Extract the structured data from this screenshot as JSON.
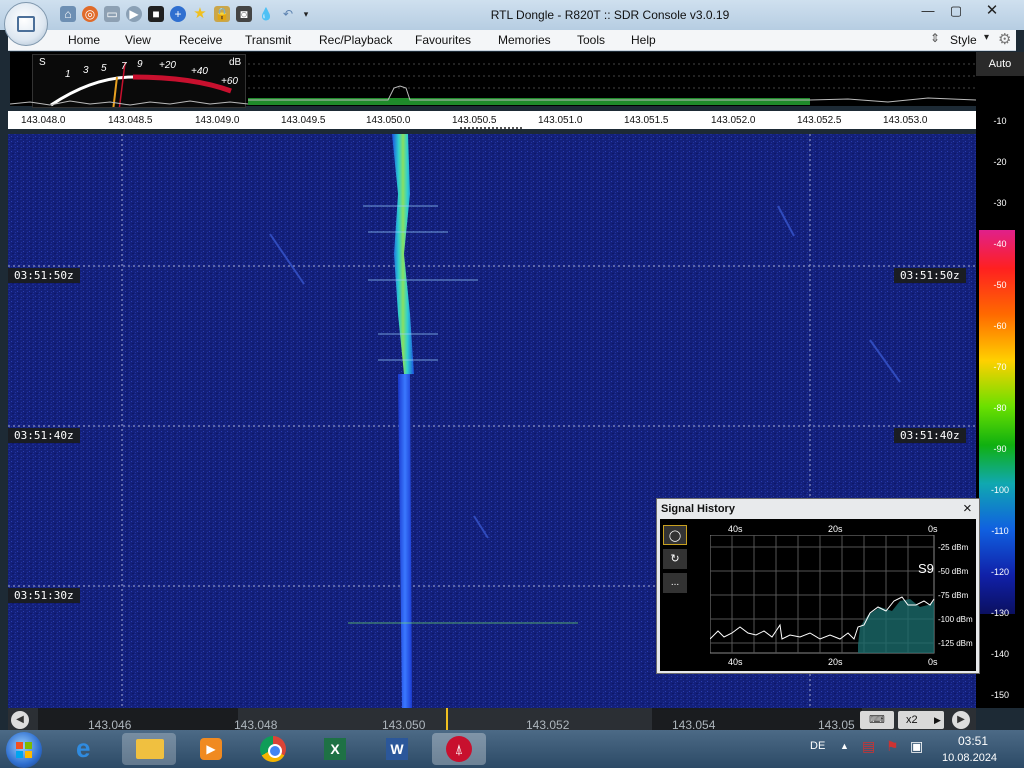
{
  "window": {
    "title": "RTL Dongle - R820T :: SDR Console v3.0.19",
    "style_label": "Style"
  },
  "menu": [
    "Home",
    "View",
    "Receive",
    "Transmit",
    "Rec/Playback",
    "Favourites",
    "Memories",
    "Tools",
    "Help"
  ],
  "smeter": {
    "s_label": "S",
    "db_label": "dB",
    "scale": [
      "1",
      "3",
      "5",
      "7",
      "9",
      "+20",
      "+40",
      "+60"
    ]
  },
  "frequency_axis": [
    "143.048.0",
    "143.048.5",
    "143.049.0",
    "143.049.5",
    "143.050.0",
    "143.050.5",
    "143.051.0",
    "143.051.5",
    "143.052.0",
    "143.052.5",
    "143.053.0"
  ],
  "waterfall": {
    "time_labels": [
      "03:51:50z",
      "03:51:40z",
      "03:51:30z"
    ]
  },
  "level_scale": {
    "auto_label": "Auto",
    "values": [
      "-10",
      "-20",
      "-30",
      "-40",
      "-50",
      "-60",
      "-70",
      "-80",
      "-90",
      "-100",
      "-110",
      "-120",
      "-130",
      "-140",
      "-150"
    ]
  },
  "bottom_bar": {
    "freqs": [
      "143.046",
      "143.048",
      "143.050",
      "143.052",
      "143.054",
      "143.05"
    ],
    "zoom": "x2"
  },
  "signal_history": {
    "title": "Signal History",
    "close": "×",
    "top_labels": [
      "40s",
      "20s",
      "0s"
    ],
    "bottom_labels": [
      "40s",
      "20s",
      "0s"
    ],
    "db_labels": [
      "-25 dBm",
      "-50 dBm",
      "-75 dBm",
      "-100 dBm",
      "-125 dBm"
    ],
    "s_reading": "S9",
    "more_label": "..."
  },
  "taskbar": {
    "language": "DE",
    "time": "03:51",
    "date": "10.08.2024"
  },
  "colors": {
    "waterfall_bg": "#13207a",
    "signal": "#39e0c0",
    "accent_red": "#c8102e"
  }
}
